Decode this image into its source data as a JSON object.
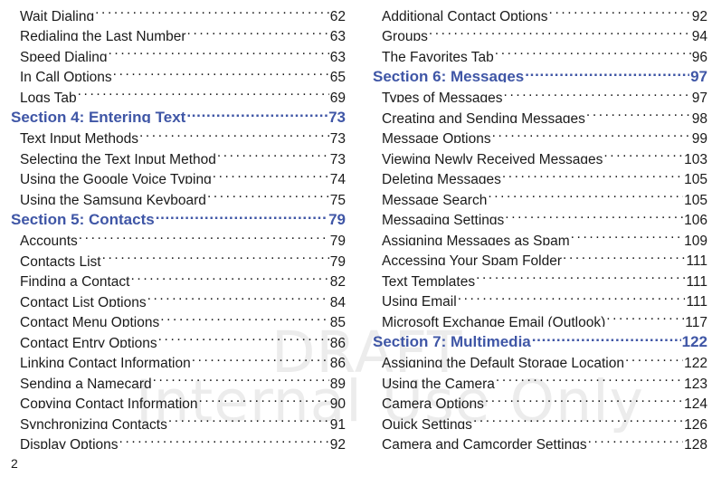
{
  "watermark": {
    "line1": "DRAFT",
    "line2": "Internal Use Only",
    "color": "#ececec"
  },
  "colors": {
    "section_heading": "#3f56a6",
    "body_text": "#1a1a1a",
    "background": "#ffffff"
  },
  "folio": {
    "page_number": "2"
  },
  "columns": {
    "left": {
      "rows": [
        {
          "type": "entry",
          "label": "Wait Dialing",
          "page": "62"
        },
        {
          "type": "entry",
          "label": "Redialing the Last Number",
          "page": "63"
        },
        {
          "type": "entry",
          "label": "Speed Dialing",
          "page": "63"
        },
        {
          "type": "entry",
          "label": "In Call Options",
          "page": "65"
        },
        {
          "type": "entry",
          "label": "Logs Tab",
          "page": "69"
        },
        {
          "type": "section",
          "label": "Section 4:  Entering Text",
          "page": "73"
        },
        {
          "type": "entry",
          "label": "Text Input Methods",
          "page": "73"
        },
        {
          "type": "entry",
          "label": "Selecting the Text Input Method",
          "page": "73"
        },
        {
          "type": "entry",
          "label": "Using the Google Voice Typing",
          "page": "74"
        },
        {
          "type": "entry",
          "label": "Using the Samsung Keyboard",
          "page": "75"
        },
        {
          "type": "section",
          "label": "Section 5:  Contacts",
          "page": "79"
        },
        {
          "type": "entry",
          "label": "Accounts",
          "page": "79"
        },
        {
          "type": "entry",
          "label": "Contacts List",
          "page": "79"
        },
        {
          "type": "entry",
          "label": "Finding a Contact",
          "page": "82"
        },
        {
          "type": "entry",
          "label": "Contact List Options",
          "page": "84"
        },
        {
          "type": "entry",
          "label": "Contact Menu Options",
          "page": "85"
        },
        {
          "type": "entry",
          "label": "Contact Entry Options",
          "page": "86"
        },
        {
          "type": "entry",
          "label": "Linking Contact Information",
          "page": "86"
        },
        {
          "type": "entry",
          "label": "Sending a Namecard",
          "page": "89"
        },
        {
          "type": "entry",
          "label": "Copying Contact Information",
          "page": "90"
        },
        {
          "type": "entry",
          "label": "Synchronizing Contacts",
          "page": "91"
        },
        {
          "type": "entry",
          "label": "Display Options",
          "page": "92"
        }
      ]
    },
    "right": {
      "rows": [
        {
          "type": "entry",
          "label": "Additional Contact Options",
          "page": "92"
        },
        {
          "type": "entry",
          "label": "Groups",
          "page": "94"
        },
        {
          "type": "entry",
          "label": "The Favorites Tab",
          "page": "96"
        },
        {
          "type": "section",
          "label": "Section 6:  Messages",
          "page": "97"
        },
        {
          "type": "entry",
          "label": "Types of Messages",
          "page": "97"
        },
        {
          "type": "entry",
          "label": "Creating and Sending Messages",
          "page": "98"
        },
        {
          "type": "entry",
          "label": "Message Options",
          "page": "99"
        },
        {
          "type": "entry",
          "label": "Viewing Newly Received Messages",
          "page": "103"
        },
        {
          "type": "entry",
          "label": "Deleting Messages",
          "page": "105"
        },
        {
          "type": "entry",
          "label": "Message Search",
          "page": "105"
        },
        {
          "type": "entry",
          "label": "Messaging Settings",
          "page": "106"
        },
        {
          "type": "entry",
          "label": "Assigning Messages as Spam",
          "page": "109"
        },
        {
          "type": "entry",
          "label": "Accessing Your Spam Folder",
          "page": "111"
        },
        {
          "type": "entry",
          "label": "Text Templates",
          "page": "111"
        },
        {
          "type": "entry",
          "label": "Using Email",
          "page": "111"
        },
        {
          "type": "entry",
          "label": "Microsoft Exchange Email (Outlook)",
          "page": "117"
        },
        {
          "type": "section",
          "label": "Section 7:  Multimedia",
          "page": "122"
        },
        {
          "type": "entry",
          "label": "Assigning the Default Storage Location",
          "page": "122"
        },
        {
          "type": "entry",
          "label": "Using the Camera",
          "page": "123"
        },
        {
          "type": "entry",
          "label": "Camera Options",
          "page": "124"
        },
        {
          "type": "entry",
          "label": "Quick Settings",
          "page": "126"
        },
        {
          "type": "entry",
          "label": "Camera and Camcorder Settings",
          "page": "128"
        }
      ]
    }
  }
}
